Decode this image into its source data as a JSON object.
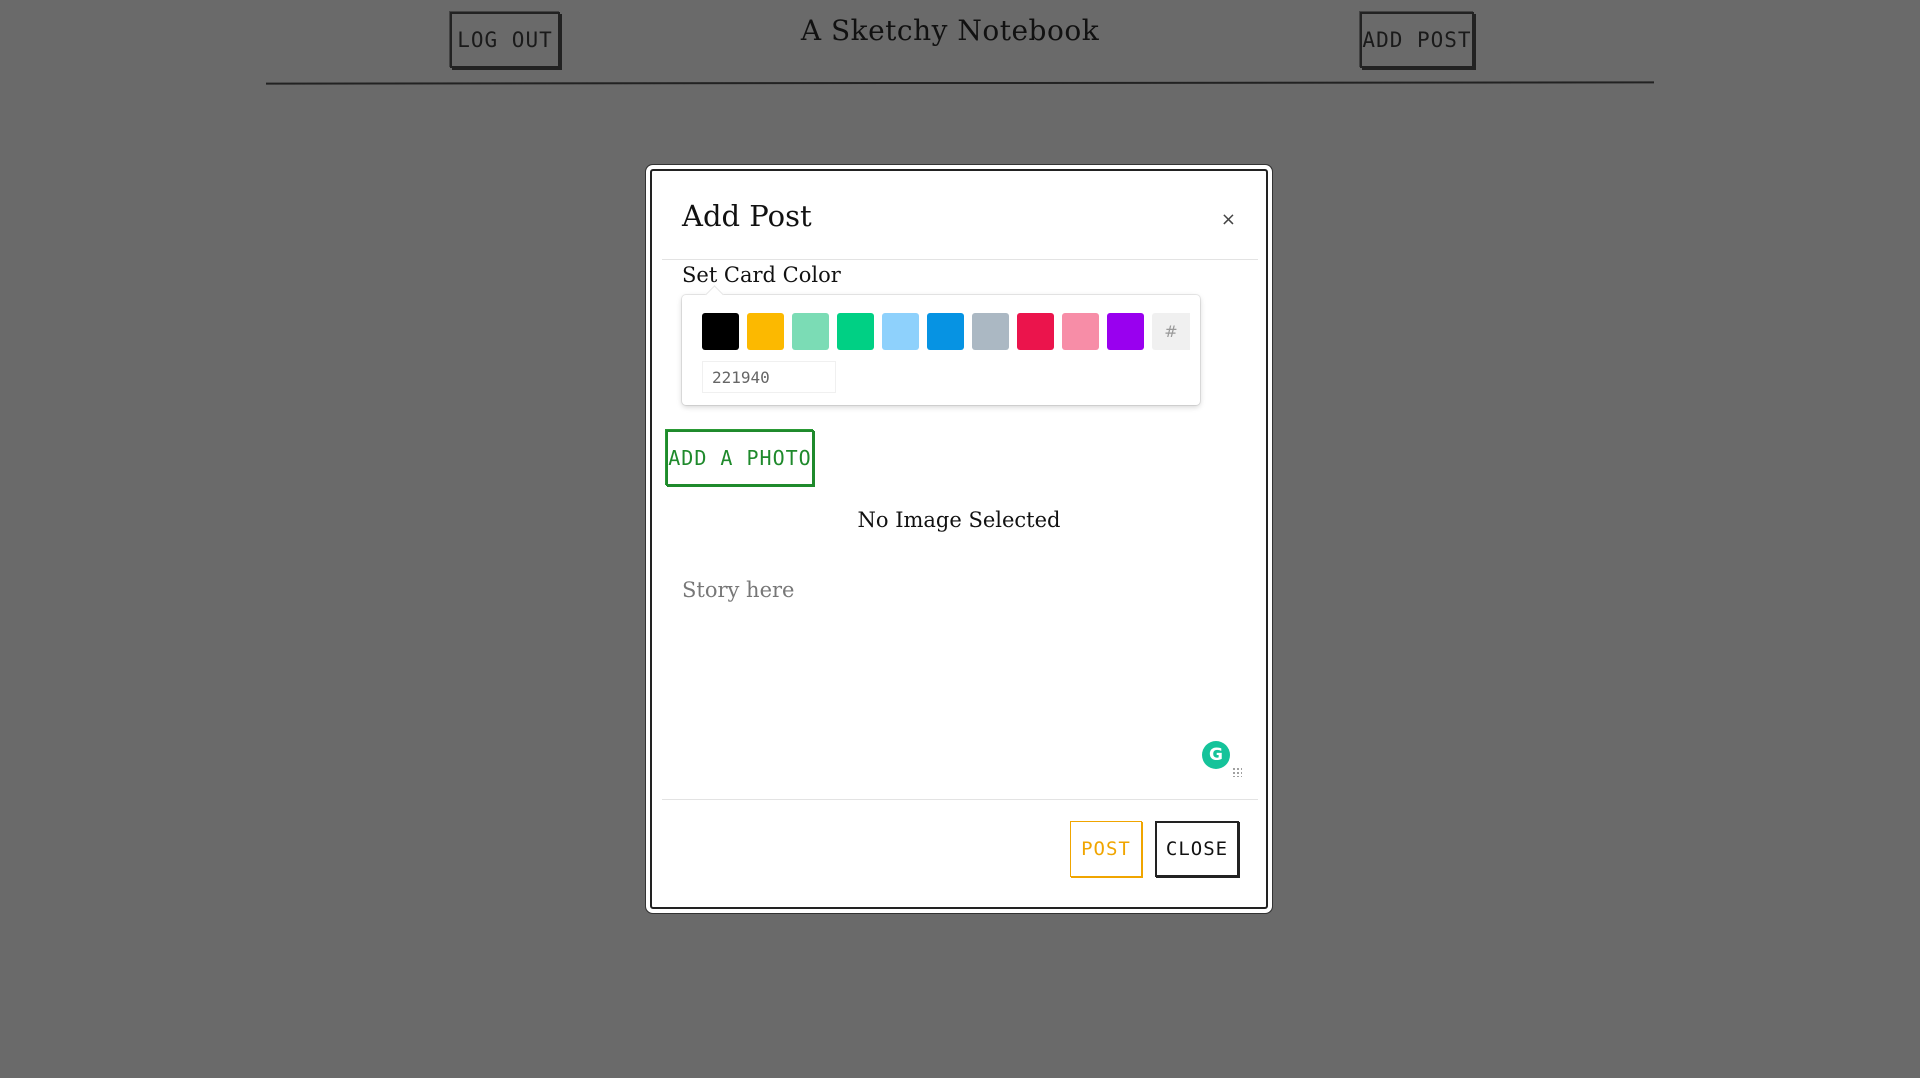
{
  "header": {
    "title": "A Sketchy Notebook",
    "logout_label": "Log out",
    "add_post_label": "Add Post"
  },
  "modal": {
    "title": "Add Post",
    "close_icon": "×",
    "color_section_label": "Set Card Color",
    "swatches": [
      {
        "name": "black",
        "color": "#000000"
      },
      {
        "name": "amber",
        "color": "#fcb900"
      },
      {
        "name": "mint",
        "color": "#7bdcb5"
      },
      {
        "name": "green",
        "color": "#00d084"
      },
      {
        "name": "light-blue",
        "color": "#8ed1fc"
      },
      {
        "name": "blue",
        "color": "#0693e3"
      },
      {
        "name": "gray",
        "color": "#abb8c3"
      },
      {
        "name": "red",
        "color": "#eb144c"
      },
      {
        "name": "pink",
        "color": "#f78da7"
      },
      {
        "name": "purple",
        "color": "#9900ef"
      }
    ],
    "hash_symbol": "#",
    "hex_value": "221940",
    "add_photo_label": "Add a Photo",
    "no_image_text": "No Image Selected",
    "story_placeholder": "Story here",
    "grammarly_letter": "G",
    "post_label": "Post",
    "close_label": "Close"
  },
  "colors": {
    "background": "#6a6a6a",
    "add_photo": "#1f8a2c",
    "post": "#f0a500",
    "grammarly": "#15c39a"
  }
}
